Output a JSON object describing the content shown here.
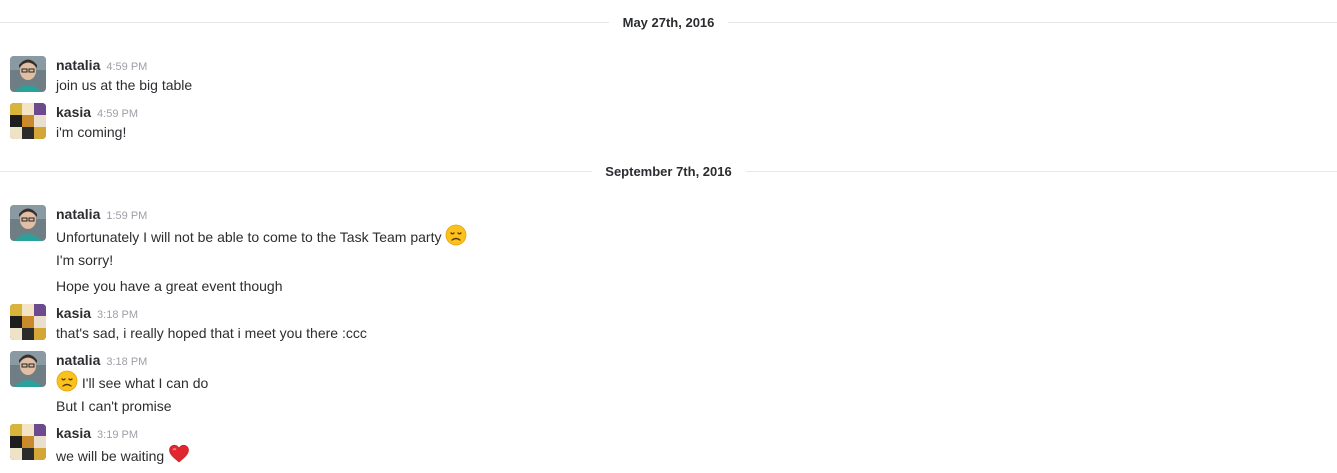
{
  "dividers": [
    {
      "label": "May 27th, 2016"
    },
    {
      "label": "September 7th, 2016"
    }
  ],
  "messages": [
    {
      "author": "natalia",
      "time": "4:59 PM",
      "lines": [
        "join us at the big table"
      ]
    },
    {
      "author": "kasia",
      "time": "4:59 PM",
      "lines": [
        "i'm coming!"
      ]
    },
    {
      "author": "natalia",
      "time": "1:59 PM",
      "lines": [
        "Unfortunately I will not be able to come to the Task Team party",
        "I'm sorry!",
        "Hope you have a great event though"
      ]
    },
    {
      "author": "kasia",
      "time": "3:18 PM",
      "lines": [
        "that's sad, i really hoped that i meet you there :ccc"
      ]
    },
    {
      "author": "natalia",
      "time": "3:18 PM",
      "lines": [
        "I'll see what I can do",
        "But I can't promise"
      ]
    },
    {
      "author": "kasia",
      "time": "3:19 PM",
      "lines": [
        "we will be waiting"
      ]
    }
  ],
  "emojis": {
    "disappointed": "disappointed-face-emoji",
    "heart": "red-heart-emoji"
  },
  "colors": {
    "text": "#2c2d30",
    "timestamp": "#9e9ea6",
    "divider_rule": "#e8e8e8"
  }
}
